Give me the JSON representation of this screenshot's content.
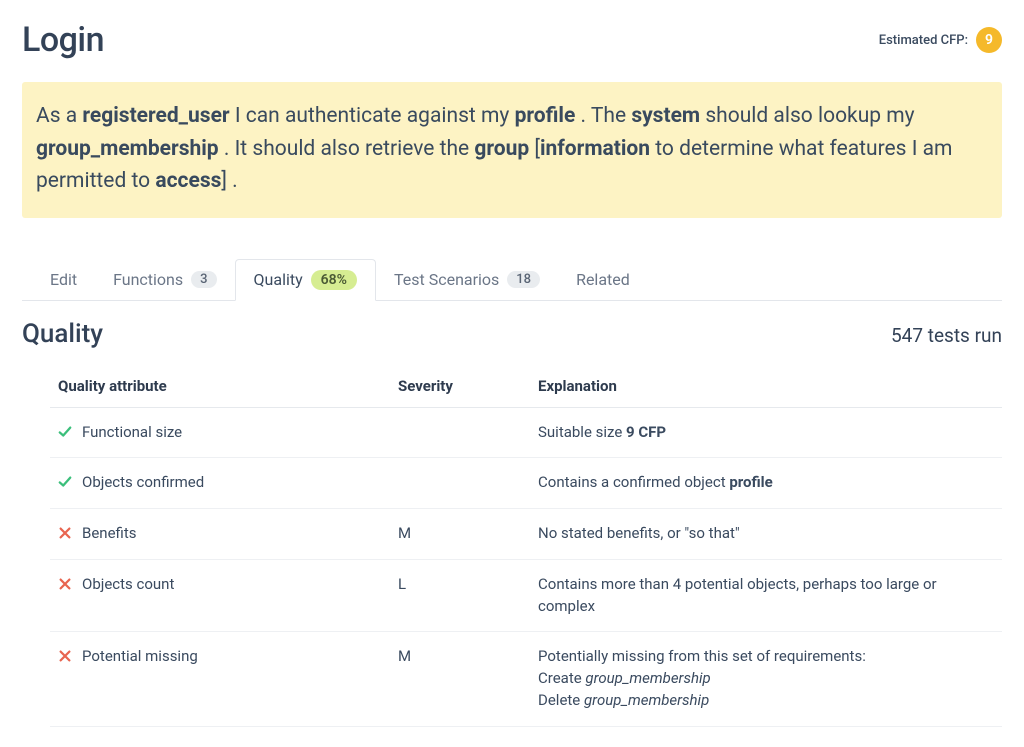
{
  "header": {
    "title": "Login",
    "cfp_label": "Estimated CFP:",
    "cfp_value": "9"
  },
  "story": {
    "segments": [
      {
        "t": "As a ",
        "b": false
      },
      {
        "t": "registered_user",
        "b": true
      },
      {
        "t": " I can authenticate against my ",
        "b": false
      },
      {
        "t": "profile",
        "b": true
      },
      {
        "t": " . The ",
        "b": false
      },
      {
        "t": "system",
        "b": true
      },
      {
        "t": " should also lookup my ",
        "b": false
      },
      {
        "t": "group_membership",
        "b": true
      },
      {
        "t": " . It should also retrieve the ",
        "b": false
      },
      {
        "t": "group",
        "b": true
      },
      {
        "t": " [",
        "b": false
      },
      {
        "t": "information",
        "b": true
      },
      {
        "t": " to determine what features I am permitted to ",
        "b": false
      },
      {
        "t": "access",
        "b": true
      },
      {
        "t": "] .",
        "b": false
      }
    ]
  },
  "tabs": {
    "edit": "Edit",
    "functions": "Functions",
    "functions_count": "3",
    "quality": "Quality",
    "quality_pct": "68%",
    "scenarios": "Test Scenarios",
    "scenarios_count": "18",
    "related": "Related"
  },
  "quality": {
    "section_title": "Quality",
    "tests_run": "547 tests run",
    "columns": {
      "attr": "Quality attribute",
      "severity": "Severity",
      "explanation": "Explanation"
    },
    "rows": [
      {
        "status": "pass",
        "attr": "Functional size",
        "severity": "",
        "explanation": [
          {
            "t": "Suitable size "
          },
          {
            "t": "9 CFP",
            "b": true
          }
        ]
      },
      {
        "status": "pass",
        "attr": "Objects confirmed",
        "severity": "",
        "explanation": [
          {
            "t": "Contains a confirmed object "
          },
          {
            "t": "profile",
            "b": true
          }
        ]
      },
      {
        "status": "fail",
        "attr": "Benefits",
        "severity": "M",
        "explanation": [
          {
            "t": "No stated benefits, or \"so that\""
          }
        ]
      },
      {
        "status": "fail",
        "attr": "Objects count",
        "severity": "L",
        "explanation": [
          {
            "t": "Contains more than 4 potential objects, perhaps too large or complex"
          }
        ]
      },
      {
        "status": "fail",
        "attr": "Potential missing",
        "severity": "M",
        "explanation": [
          {
            "t": "Potentially missing from this set of requirements:"
          },
          {
            "br": true
          },
          {
            "t": "Create "
          },
          {
            "t": "group_membership",
            "i": true
          },
          {
            "br": true
          },
          {
            "t": "Delete "
          },
          {
            "t": "group_membership",
            "i": true
          }
        ]
      }
    ]
  }
}
